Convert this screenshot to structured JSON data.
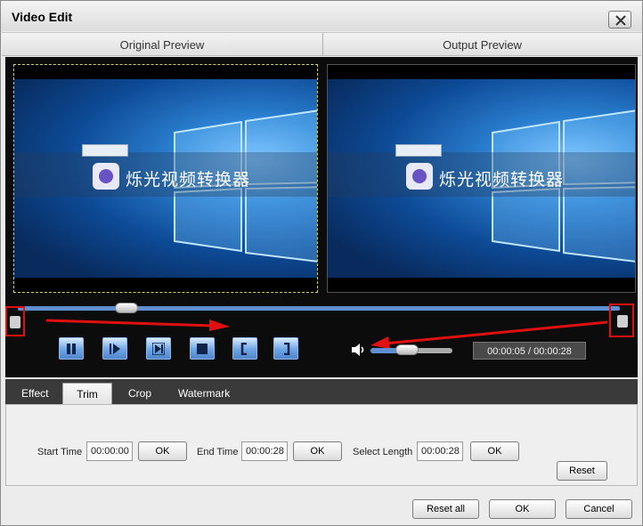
{
  "window": {
    "title": "Video Edit"
  },
  "preview": {
    "original_label": "Original Preview",
    "output_label": "Output Preview",
    "app_name_overlay": "烁光视频转换器"
  },
  "player": {
    "seek_position_fraction": 0.18,
    "volume_fraction": 0.45,
    "time_display": "00:00:05 / 00:00:28"
  },
  "tabs": [
    {
      "label": "Effect",
      "active": false
    },
    {
      "label": "Trim",
      "active": true
    },
    {
      "label": "Crop",
      "active": false
    },
    {
      "label": "Watermark",
      "active": false
    }
  ],
  "trim": {
    "start_label": "Start Time",
    "start_value": "00:00:00",
    "end_label": "End Time",
    "end_value": "00:00:28",
    "length_label": "Select Length",
    "length_value": "00:00:28",
    "ok_label": "OK",
    "reset_label": "Reset"
  },
  "footer": {
    "reset_all_label": "Reset all",
    "ok_label": "OK",
    "cancel_label": "Cancel"
  },
  "annotation_color": "#e01010",
  "accent_color": "#5f8fd0"
}
